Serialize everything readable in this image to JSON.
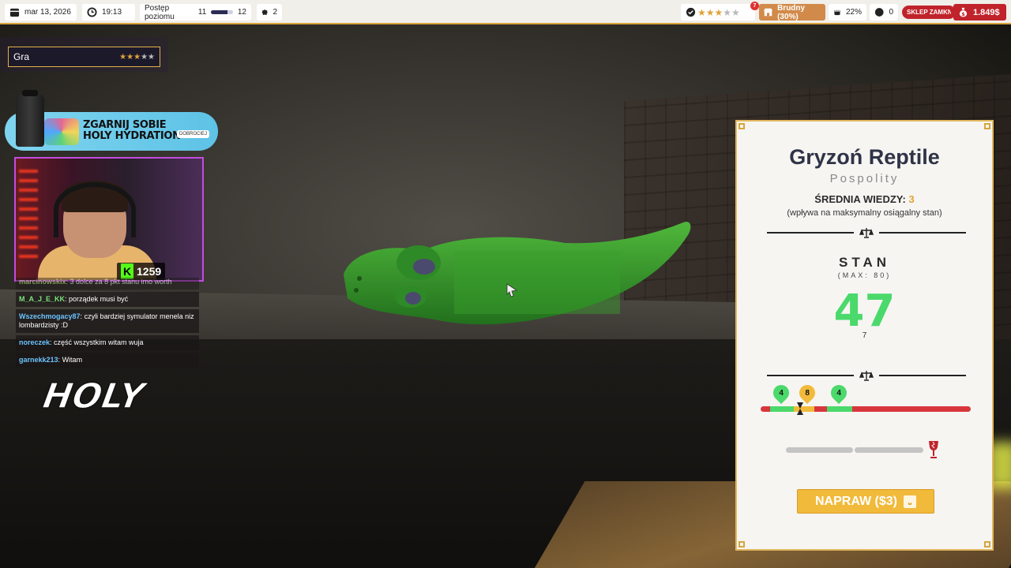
{
  "topbar": {
    "date": "mar 13, 2026",
    "time": "19:13",
    "level_label": "Postęp poziomu",
    "level_from": "11",
    "level_to": "12",
    "level_progress": 0.75,
    "parts_count": "2",
    "rating_badge": "7",
    "rating_stars": 3,
    "rating_max": 5,
    "dirty_label": "Brudny (30%)",
    "strength_label": "22%",
    "mess_count": "0",
    "shop_label": "SKLEP ZAMKNIĘTY",
    "money": "1.849$",
    "colors": {
      "accent": "#d8a23a",
      "red": "#c1232b",
      "dirty": "#d28a4a"
    }
  },
  "game_box": {
    "label": "Gra",
    "stars": 3,
    "max": 5
  },
  "promo": {
    "line1": "ZGARNIJ SOBIE",
    "line2": "HOLY HYDRATION",
    "button": "DOBROCIEJ"
  },
  "webcam": {
    "viewer_count": "1259"
  },
  "chat": [
    {
      "user": "marcinowskix",
      "text": "3 dolce za 8 pkt stanu imo worth",
      "color": "#b9e27a"
    },
    {
      "user": "M_A_J_E_KK",
      "text": "porządek musi być",
      "color": "#7ee07a"
    },
    {
      "user": "Wszechmogacy87",
      "text": "czyli bardziej symulator menela niz lombardzisty :D",
      "color": "#6cc4ff"
    },
    {
      "user": "noreczek",
      "text": "część wszystkim witam wuja",
      "color": "#6cc4ff"
    },
    {
      "user": "garnekk213",
      "text": "Witam",
      "color": "#6cc4ff"
    }
  ],
  "brand_logo": "HOLY",
  "panel": {
    "title": "Gryzoń Reptile",
    "rarity": "Pospolity",
    "avg_label": "ŚREDNIA WIEDZY:",
    "avg_value": "3",
    "avg_note": "(wpływa na maksymalny osiągalny stan)",
    "stan_label": "STAN",
    "stan_max": "(MAX: 80)",
    "stan_value": "47",
    "stan_sub": "7",
    "range_pins": [
      {
        "label": "4",
        "color": "#4bd96b",
        "pos": 0.1
      },
      {
        "label": "8",
        "color": "#f2ba3b",
        "pos": 0.225
      },
      {
        "label": "4",
        "color": "#4bd96b",
        "pos": 0.375
      }
    ],
    "repair_button": "NAPRAW ($3)",
    "colors": {
      "value": "#4bd96b",
      "button": "#f2ba3b",
      "bar": "#d8363d"
    }
  }
}
